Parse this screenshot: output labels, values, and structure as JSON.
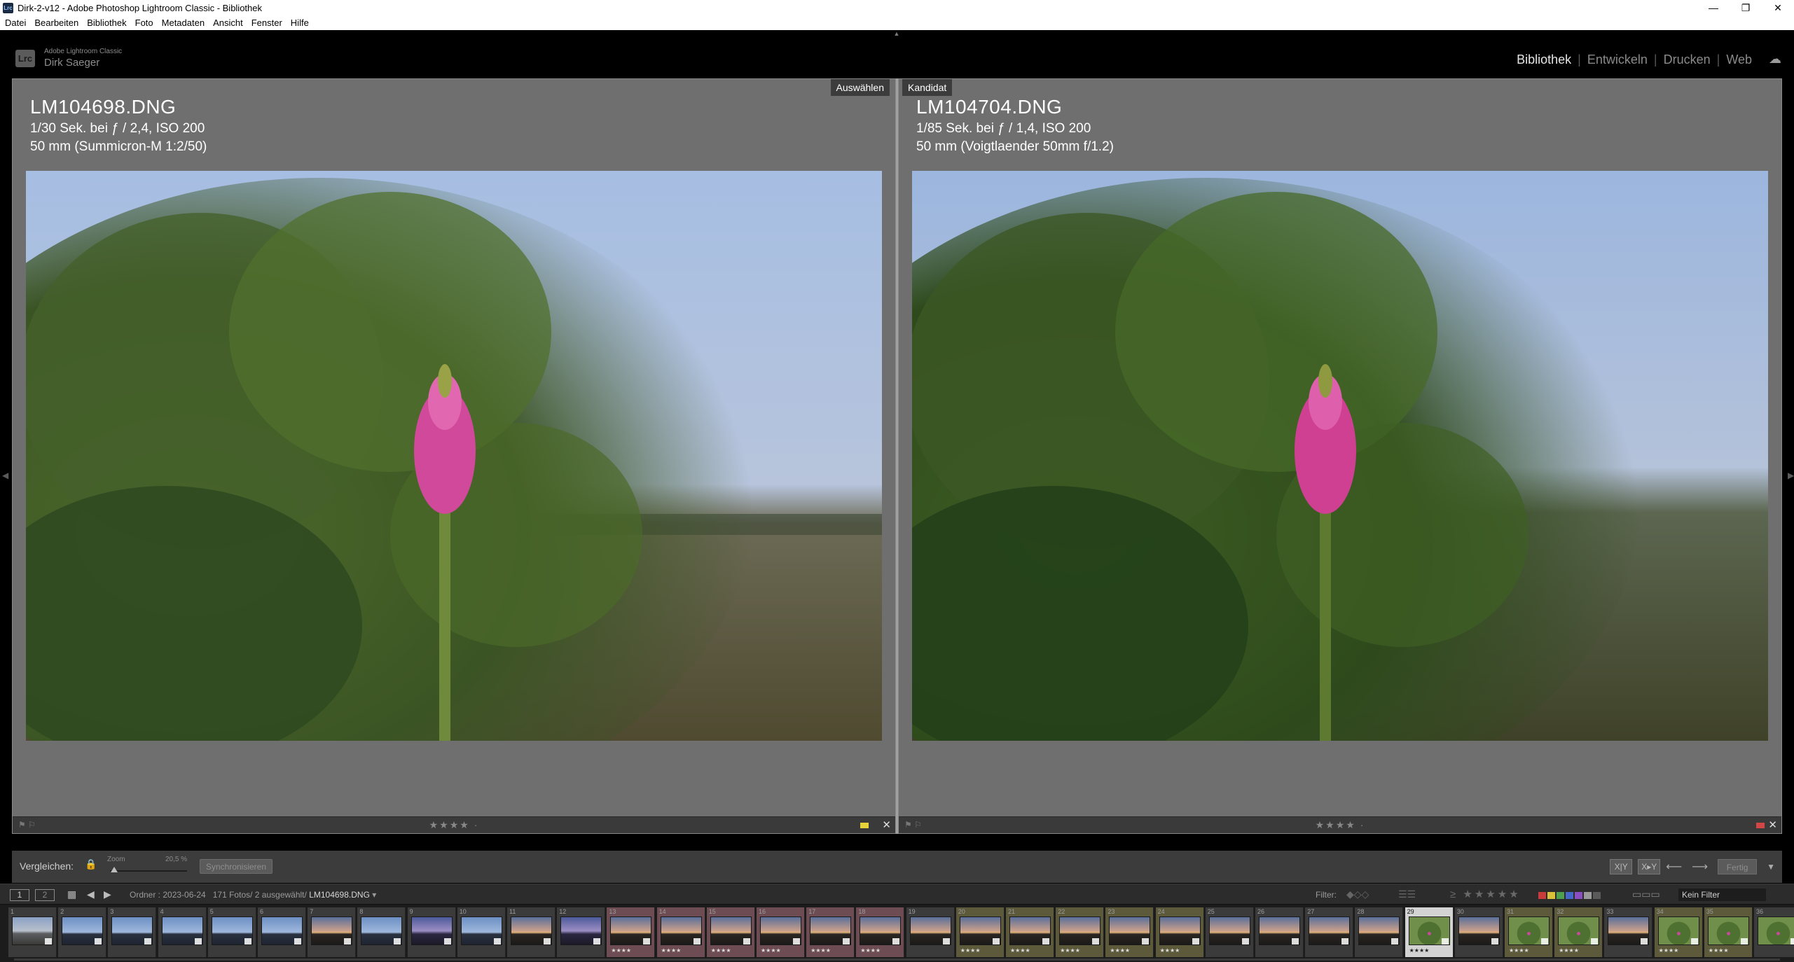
{
  "window": {
    "title": "Dirk-2-v12 - Adobe Photoshop Lightroom Classic - Bibliothek",
    "app_icon": "Lrc",
    "controls": {
      "minimize": "—",
      "restore": "❐",
      "close": "✕"
    }
  },
  "menu": [
    "Datei",
    "Bearbeiten",
    "Bibliothek",
    "Foto",
    "Metadaten",
    "Ansicht",
    "Fenster",
    "Hilfe"
  ],
  "identity": {
    "logo": "Lrc",
    "brand": "Adobe Lightroom Classic",
    "user": "Dirk Saeger"
  },
  "modules": [
    {
      "label": "Bibliothek",
      "active": true
    },
    {
      "label": "Entwickeln",
      "active": false
    },
    {
      "label": "Drucken",
      "active": false
    },
    {
      "label": "Web",
      "active": false
    }
  ],
  "compare": {
    "left": {
      "tag": "Auswählen",
      "filename": "LM104698.DNG",
      "exposure": "1/30 Sek. bei ƒ / 2,4, ISO 200",
      "lens": "50 mm (Summicron-M 1:2/50)",
      "rating": "★★★★ ·",
      "label_color": "#e5d23a"
    },
    "right": {
      "tag": "Kandidat",
      "filename": "LM104704.DNG",
      "exposure": "1/85 Sek. bei ƒ / 1,4, ISO 200",
      "lens": "50 mm (Voigtlaender 50mm f/1.2)",
      "rating": "★★★★ ·",
      "label_color": "#d24646"
    }
  },
  "toolbar": {
    "label": "Vergleichen:",
    "zoom_label": "Zoom",
    "zoom_value": "20,5 %",
    "zoom_level": 0.05,
    "sync_button": "Synchronisieren",
    "done_button": "Fertig"
  },
  "filmstrip_bar": {
    "page_1": "1",
    "page_2": "2",
    "folder_label": "Ordner : 2023-06-24",
    "counts": "171 Fotos/ 2 ausgewählt/",
    "current_file": "LM104698.DNG",
    "filter_label": "Filter:",
    "filter_stars": "≥ ★★★★★",
    "filter_value": "Kein Filter",
    "label_colors": [
      "#c83c3c",
      "#d9c23a",
      "#4ea04e",
      "#4467c8",
      "#8a4ec0",
      "#9a9a9a",
      "#5a5a5a"
    ]
  },
  "filmstrip": [
    {
      "n": "1",
      "stars": "",
      "tint": "#3b3b3b",
      "type": "dusk"
    },
    {
      "n": "2",
      "stars": "",
      "tint": "#3b3b3b",
      "type": "blue"
    },
    {
      "n": "3",
      "stars": "",
      "tint": "#3b3b3b",
      "type": "blue"
    },
    {
      "n": "4",
      "stars": "",
      "tint": "#3b3b3b",
      "type": "blue"
    },
    {
      "n": "5",
      "stars": "",
      "tint": "#3b3b3b",
      "type": "blue"
    },
    {
      "n": "6",
      "stars": "",
      "tint": "#3b3b3b",
      "type": "blue"
    },
    {
      "n": "7",
      "stars": "",
      "tint": "#3b3b3b",
      "type": "warm"
    },
    {
      "n": "8",
      "stars": "",
      "tint": "#3b3b3b",
      "type": "blue"
    },
    {
      "n": "9",
      "stars": "",
      "tint": "#3b3b3b",
      "type": "purple"
    },
    {
      "n": "10",
      "stars": "",
      "tint": "#3b3b3b",
      "type": "blue"
    },
    {
      "n": "11",
      "stars": "",
      "tint": "#3b3b3b",
      "type": "warm"
    },
    {
      "n": "12",
      "stars": "",
      "tint": "#3b3b3b",
      "type": "purple"
    },
    {
      "n": "13",
      "stars": "★★★★",
      "tint": "#6e4c54",
      "type": "warm"
    },
    {
      "n": "14",
      "stars": "★★★★",
      "tint": "#6e4c54",
      "type": "warm"
    },
    {
      "n": "15",
      "stars": "★★★★",
      "tint": "#6e4c54",
      "type": "warm"
    },
    {
      "n": "16",
      "stars": "★★★★",
      "tint": "#6e4c54",
      "type": "warm"
    },
    {
      "n": "17",
      "stars": "★★★★",
      "tint": "#6e4c54",
      "type": "warm"
    },
    {
      "n": "18",
      "stars": "★★★★",
      "tint": "#6e4c54",
      "type": "warm"
    },
    {
      "n": "19",
      "stars": "",
      "tint": "#3b3b3b",
      "type": "warm"
    },
    {
      "n": "20",
      "stars": "★★★★",
      "tint": "#5c5a3a",
      "type": "warm"
    },
    {
      "n": "21",
      "stars": "★★★★",
      "tint": "#5c5a3a",
      "type": "warm"
    },
    {
      "n": "22",
      "stars": "★★★★",
      "tint": "#5c5a3a",
      "type": "warm"
    },
    {
      "n": "23",
      "stars": "★★★★",
      "tint": "#5c5a3a",
      "type": "warm"
    },
    {
      "n": "24",
      "stars": "★★★★",
      "tint": "#5c5a3a",
      "type": "warm"
    },
    {
      "n": "25",
      "stars": "",
      "tint": "#3b3b3b",
      "type": "warm"
    },
    {
      "n": "26",
      "stars": "",
      "tint": "#3b3b3b",
      "type": "warm"
    },
    {
      "n": "27",
      "stars": "",
      "tint": "#3b3b3b",
      "type": "warm"
    },
    {
      "n": "28",
      "stars": "",
      "tint": "#3b3b3b",
      "type": "warm"
    },
    {
      "n": "29",
      "stars": "★★★★",
      "tint": "#d3d3d3",
      "type": "green",
      "selected": true
    },
    {
      "n": "30",
      "stars": "",
      "tint": "#3b3b3b",
      "type": "warm"
    },
    {
      "n": "31",
      "stars": "★★★★",
      "tint": "#5c5a3a",
      "type": "green"
    },
    {
      "n": "32",
      "stars": "★★★★",
      "tint": "#5c5a3a",
      "type": "green"
    },
    {
      "n": "33",
      "stars": "",
      "tint": "#3b3b3b",
      "type": "warm"
    },
    {
      "n": "34",
      "stars": "★★★★",
      "tint": "#5c5a3a",
      "type": "green"
    },
    {
      "n": "35",
      "stars": "★★★★",
      "tint": "#5c5a3a",
      "type": "green"
    },
    {
      "n": "36",
      "stars": "",
      "tint": "#3b3b3b",
      "type": "green"
    }
  ]
}
